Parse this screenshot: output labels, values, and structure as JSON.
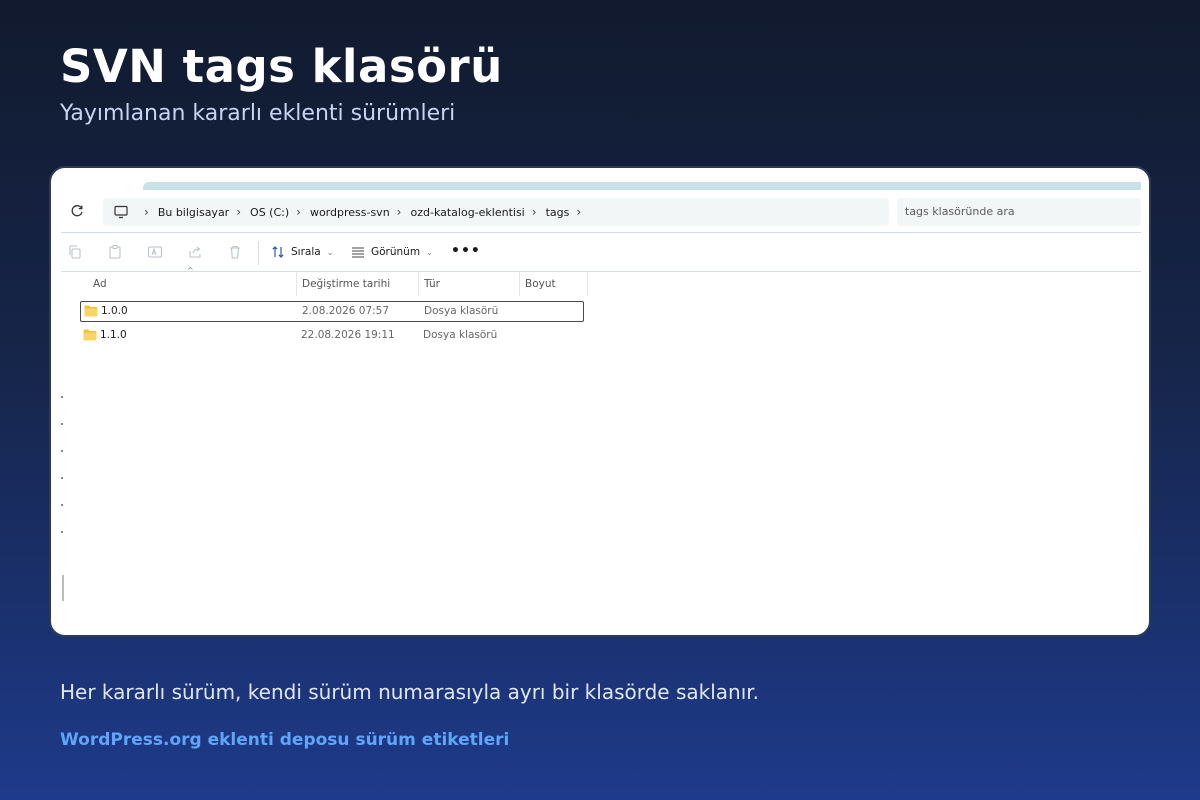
{
  "slide": {
    "title": "SVN tags klasörü",
    "subtitle": "Yayımlanan kararlı eklenti sürümleri",
    "caption": "Her kararlı sürüm, kendi sürüm numarasıyla ayrı bir klasörde saklanır.",
    "source": "WordPress.org eklenti deposu sürüm etiketleri"
  },
  "explorer": {
    "breadcrumb": [
      "Bu bilgisayar",
      "OS (C:)",
      "wordpress-svn",
      "ozd-katalog-eklentisi",
      "tags"
    ],
    "search_placeholder": "tags klasöründe ara",
    "toolbar": {
      "sort_label": "Sırala",
      "view_label": "Görünüm",
      "more_label": "•••",
      "icons": [
        "copy-icon",
        "paste-icon",
        "rename-icon",
        "share-icon",
        "delete-icon"
      ]
    },
    "columns": [
      "Ad",
      "Değiştirme tarihi",
      "Tür",
      "Boyut"
    ],
    "rows": [
      {
        "name": "1.0.0",
        "modified": "2.08.2026 07:57",
        "type": "Dosya klasörü",
        "size": "",
        "selected": true
      },
      {
        "name": "1.1.0",
        "modified": "22.08.2026 19:11",
        "type": "Dosya klasörü",
        "size": "",
        "selected": false
      }
    ]
  },
  "colors": {
    "accent": "#60a5fa",
    "folder": "#f3c13a",
    "tabstrip": "#c9e2ea"
  }
}
